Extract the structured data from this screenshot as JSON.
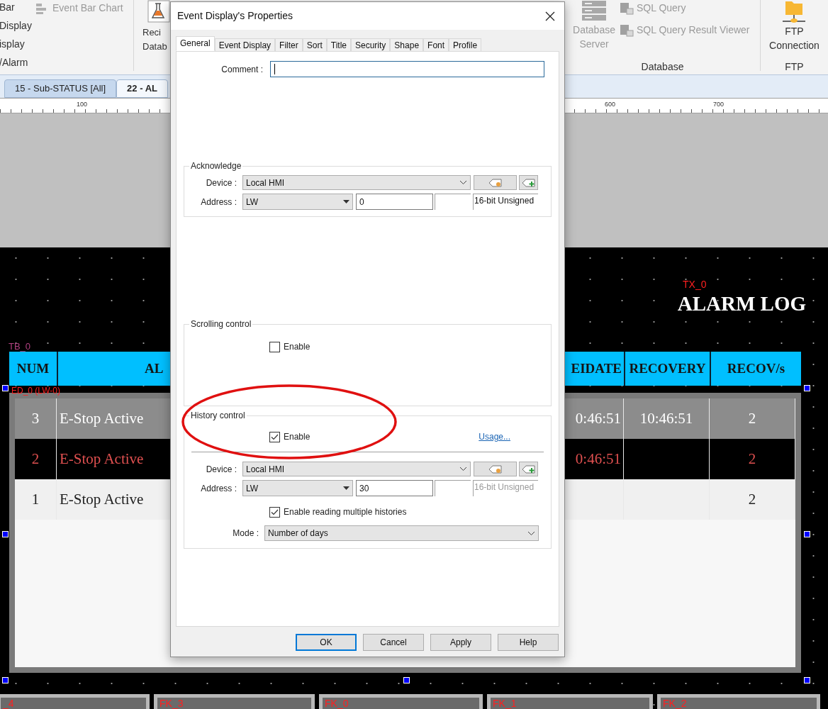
{
  "ribbon": {
    "left_items": [
      "Bar",
      "Display",
      "isplay",
      "/Alarm"
    ],
    "event_bar_chart": {
      "label": "Event Bar Chart",
      "disabled": true
    },
    "recipe": {
      "lines": [
        "Reci",
        "Datab"
      ]
    },
    "database_server": {
      "lines": [
        "Database",
        "Server"
      ],
      "disabled": true
    },
    "sql_items": [
      {
        "label": "SQL Query",
        "disabled": true
      },
      {
        "label": "SQL Query Result Viewer",
        "disabled": true
      }
    ],
    "ftp": {
      "lines": [
        "FTP",
        "Connection"
      ]
    },
    "groups": [
      "Database",
      "FTP"
    ]
  },
  "document_tabs": [
    {
      "label": "15 - Sub-STATUS [All]",
      "selected": false
    },
    {
      "label": "22 - AL",
      "selected": true
    }
  ],
  "ruler": {
    "ticks": [
      "100",
      "600",
      "700"
    ]
  },
  "canvas": {
    "title": "ALARM LOG",
    "object_labels": [
      "TX_0",
      "TB_0",
      "ED_0 (LW-0)"
    ],
    "header": [
      "NUM",
      "AL",
      "EIDATE",
      "RECOVERY",
      "RECOV/s"
    ],
    "rows": [
      {
        "kind": "recovered",
        "cells": [
          "3",
          "E-Stop Active",
          "0:46:51",
          "10:46:51",
          "2"
        ]
      },
      {
        "kind": "active",
        "cells": [
          "2",
          "E-Stop Active",
          "0:46:51",
          null,
          "2"
        ]
      },
      {
        "kind": "acknowledged",
        "cells": [
          "1",
          "E-Stop Active",
          null,
          null,
          "2"
        ]
      }
    ],
    "function_keys": [
      "_4",
      "FK_3",
      "FK_0",
      "FK_1",
      "FK_2"
    ]
  },
  "dialog": {
    "title": "Event Display's Properties",
    "tabs": [
      {
        "label": "General",
        "selected": true
      },
      {
        "label": "Event Display",
        "selected": false
      },
      {
        "label": "Filter",
        "selected": false
      },
      {
        "label": "Sort",
        "selected": false
      },
      {
        "label": "Title",
        "selected": false
      },
      {
        "label": "Security",
        "selected": false
      },
      {
        "label": "Shape",
        "selected": false
      },
      {
        "label": "Font",
        "selected": false
      },
      {
        "label": "Profile",
        "selected": false
      }
    ],
    "comment": {
      "label": "Comment :",
      "focused": true
    },
    "acknowledge": {
      "title": "Acknowledge",
      "device_label": "Device :",
      "device": "Local HMI",
      "address_label": "Address :",
      "address_type": "LW",
      "address": "0",
      "data_type": "16-bit Unsigned",
      "data_type_disabled": false
    },
    "scrolling_control": {
      "title": "Scrolling control",
      "enable": {
        "label": "Enable",
        "checked": false
      }
    },
    "history_control": {
      "title": "History control",
      "enable": {
        "label": "Enable",
        "checked": true
      },
      "usage_link": "Usage...",
      "device_label": "Device :",
      "device": "Local HMI",
      "address_label": "Address :",
      "address_type": "LW",
      "address": "30",
      "data_type": "16-bit Unsigned",
      "data_type_disabled": true,
      "multiple": {
        "label": "Enable reading multiple histories",
        "checked": true
      },
      "mode_label": "Mode :",
      "mode": "Number of days"
    },
    "buttons": [
      {
        "label": "OK",
        "default": true
      },
      {
        "label": "Cancel",
        "default": false
      },
      {
        "label": "Apply",
        "default": false
      },
      {
        "label": "Help",
        "default": false
      }
    ]
  }
}
